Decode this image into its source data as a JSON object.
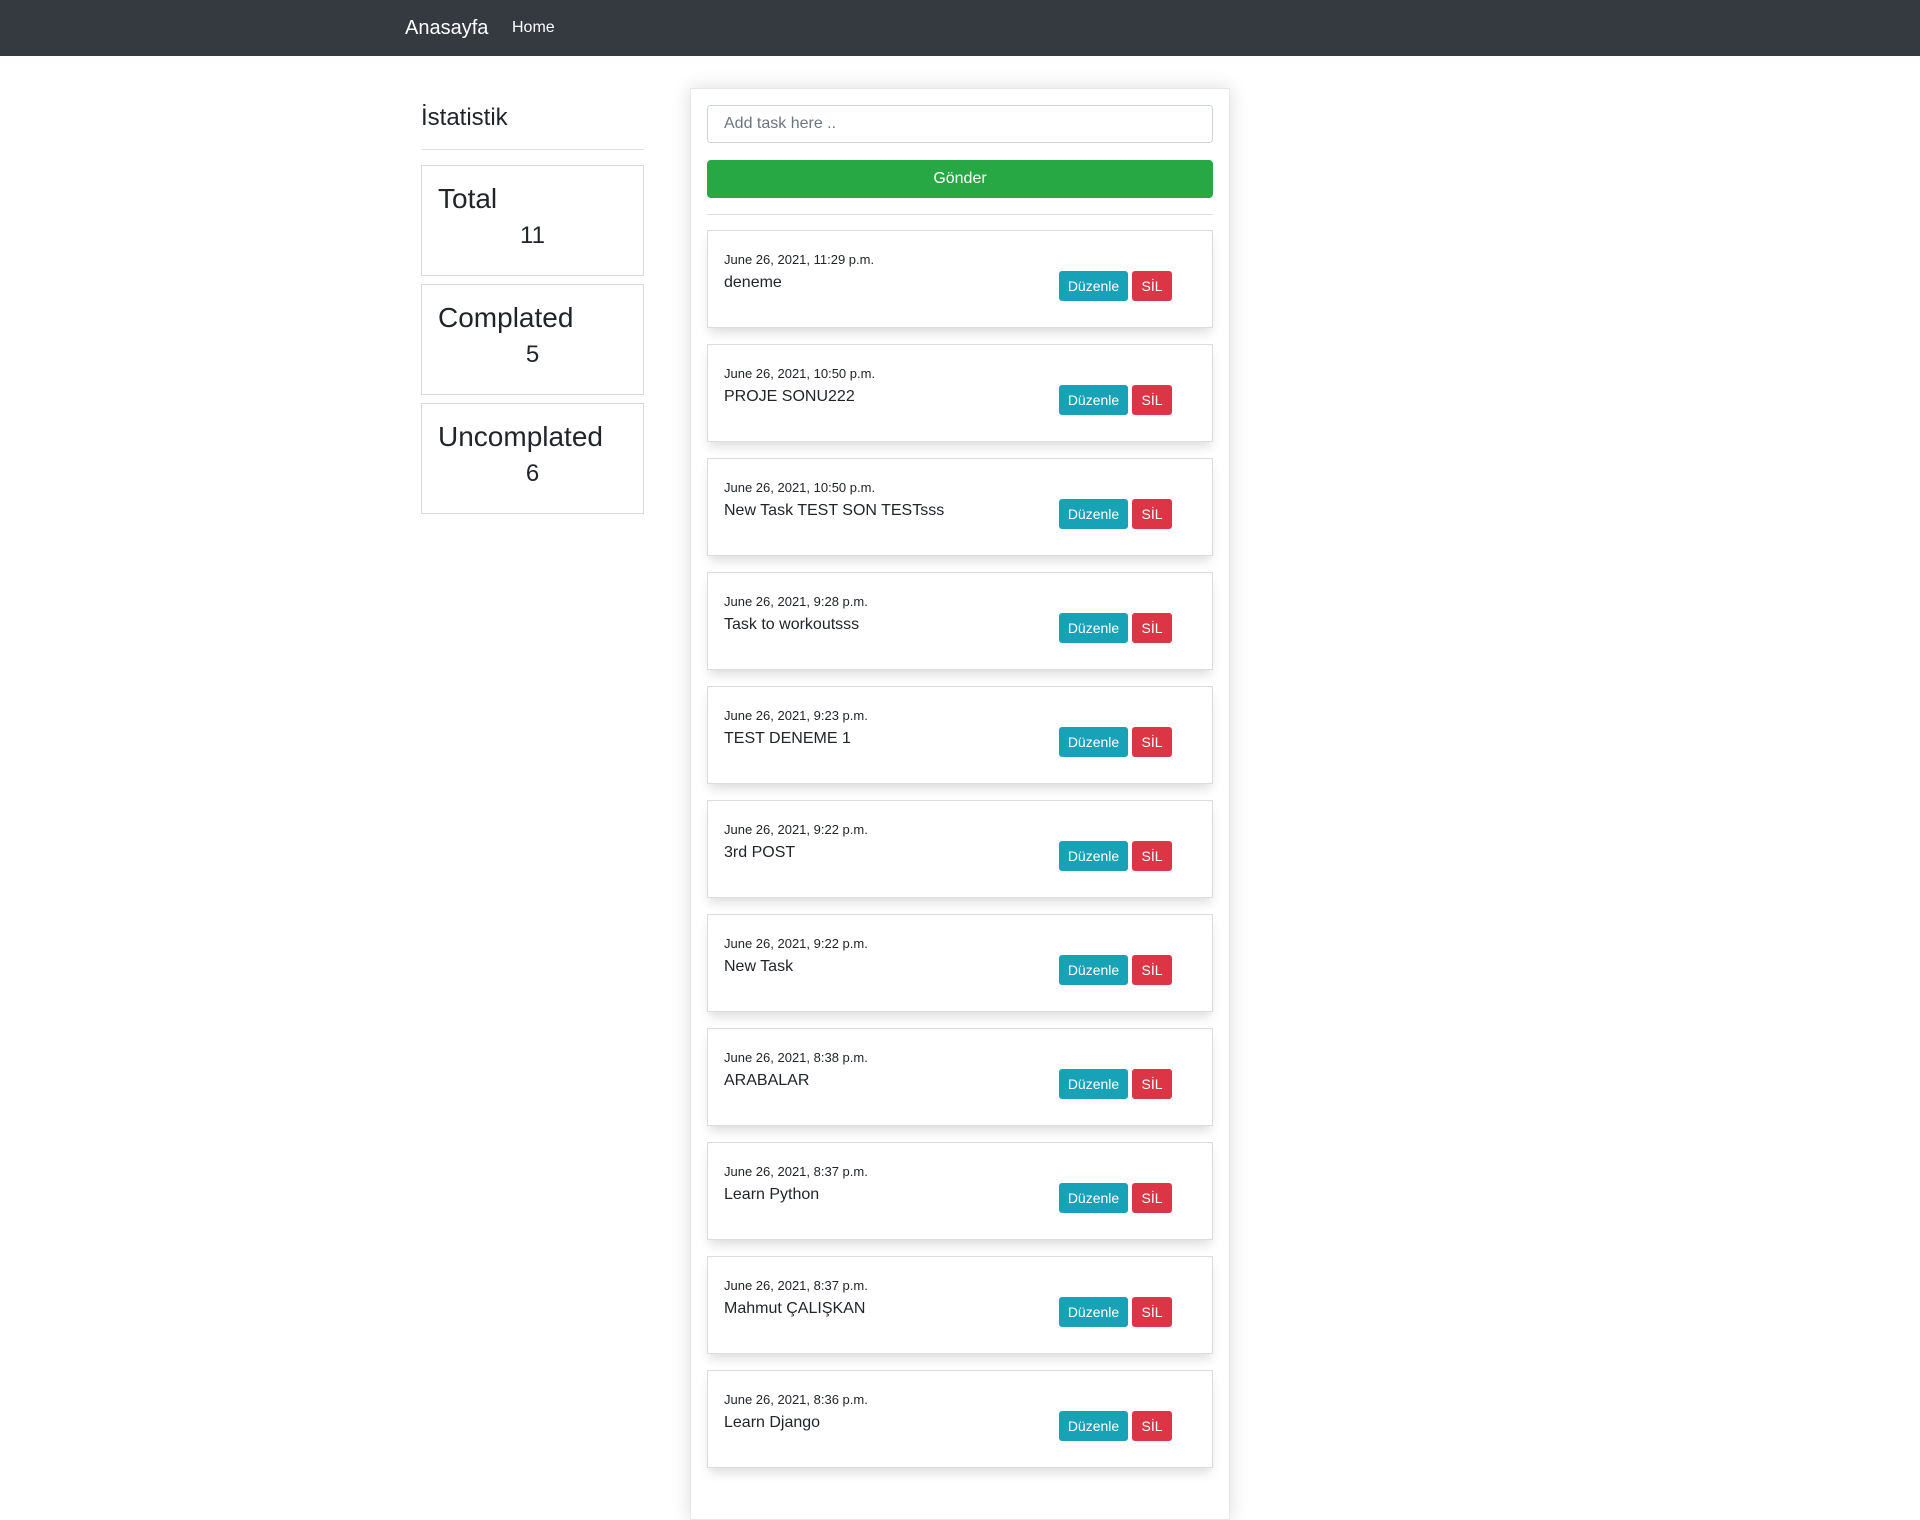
{
  "navbar": {
    "brand": "Anasayfa",
    "home": "Home"
  },
  "stats": {
    "title": "İstatistik",
    "cards": [
      {
        "label": "Total",
        "value": "11"
      },
      {
        "label": "Complated",
        "value": "5"
      },
      {
        "label": "Uncomplated",
        "value": "6"
      }
    ]
  },
  "form": {
    "placeholder": "Add task here ..",
    "value": "",
    "submit_label": "Gönder"
  },
  "task_actions": {
    "edit_label": "Düzenle",
    "delete_label": "SİL"
  },
  "tasks": [
    {
      "date": "June 26, 2021, 11:29 p.m.",
      "title": "deneme"
    },
    {
      "date": "June 26, 2021, 10:50 p.m.",
      "title": "PROJE SONU222"
    },
    {
      "date": "June 26, 2021, 10:50 p.m.",
      "title": "New Task TEST SON TESTsss"
    },
    {
      "date": "June 26, 2021, 9:28 p.m.",
      "title": "Task to workoutsss"
    },
    {
      "date": "June 26, 2021, 9:23 p.m.",
      "title": "TEST DENEME 1"
    },
    {
      "date": "June 26, 2021, 9:22 p.m.",
      "title": "3rd POST"
    },
    {
      "date": "June 26, 2021, 9:22 p.m.",
      "title": "New Task"
    },
    {
      "date": "June 26, 2021, 8:38 p.m.",
      "title": "ARABALAR"
    },
    {
      "date": "June 26, 2021, 8:37 p.m.",
      "title": "Learn Python"
    },
    {
      "date": "June 26, 2021, 8:37 p.m.",
      "title": "Mahmut ÇALIŞKAN"
    },
    {
      "date": "June 26, 2021, 8:36 p.m.",
      "title": "Learn Django"
    }
  ],
  "colors": {
    "navbar": "#343a40",
    "success": "#28a745",
    "info": "#17a2b8",
    "danger": "#dc3545"
  }
}
